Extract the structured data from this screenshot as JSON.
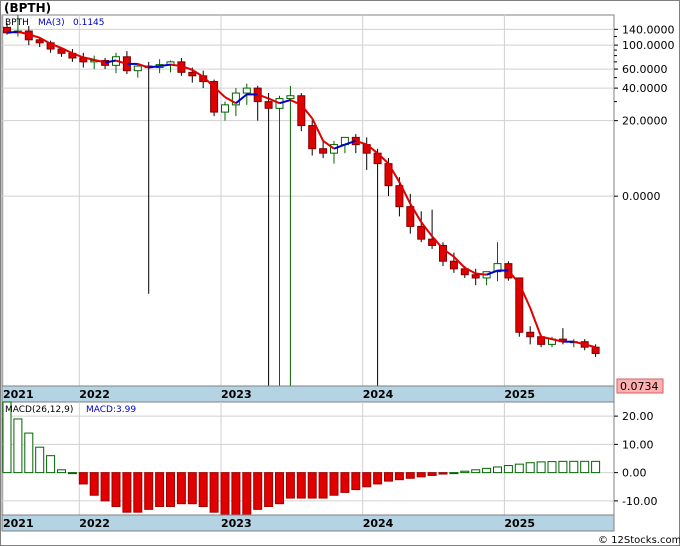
{
  "title": "(BPTH)",
  "price_panel": {
    "ticker": "BPTH",
    "ma_label": "MA(3)",
    "ma_value": "0.1145",
    "last_price_label": "0.0734",
    "y_tick_labels": [
      "140.0000",
      "100.0000",
      "60.0000",
      "40.0000",
      "20.0000",
      "0.0000"
    ],
    "y_tick_values": [
      140,
      100,
      60,
      40,
      20,
      0
    ]
  },
  "macd_panel": {
    "label": "MACD(26,12,9)",
    "value_label": "MACD:3.99",
    "y_tick_labels": [
      "20.00",
      "10.00",
      "0.00",
      "-10.00"
    ],
    "y_tick_values": [
      20,
      10,
      0,
      -10
    ]
  },
  "x_axis_labels": [
    "2021",
    "2022",
    "2023",
    "2024",
    "2025"
  ],
  "watermark": "© 12Stocks.com",
  "colors": {
    "up_candle": "#ffffff",
    "up_outline": "#006400",
    "down_candle": "#e00000",
    "ma_up": "#0000cc",
    "ma_down": "#e00000",
    "macd_pos": "#ffffff",
    "macd_pos_outline": "#006400",
    "macd_neg": "#e00000",
    "axis_band": "#b4d4e4",
    "last_price_bg": "#ffb0b0"
  },
  "chart_data": [
    {
      "type": "candlestick",
      "title": "(BPTH)",
      "y_scale": "log",
      "period": "monthly",
      "series": [
        {
          "name": "BPTH",
          "ohlc": [
            [
              146,
              160,
              125,
              130
            ],
            [
              130,
              190,
              120,
              135
            ],
            [
              135,
              150,
              100,
              112
            ],
            [
              112,
              118,
              96,
              105
            ],
            [
              105,
              110,
              85,
              92
            ],
            [
              92,
              95,
              78,
              84
            ],
            [
              84,
              92,
              70,
              76
            ],
            [
              76,
              85,
              62,
              70
            ],
            [
              70,
              80,
              60,
              72
            ],
            [
              72,
              76,
              60,
              65
            ],
            [
              65,
              85,
              55,
              78
            ],
            [
              78,
              88,
              54,
              58
            ],
            [
              58,
              66,
              50,
              64
            ],
            [
              64,
              70,
              0.5,
              62
            ],
            [
              62,
              74,
              55,
              66
            ],
            [
              66,
              72,
              56,
              70
            ],
            [
              70,
              76,
              52,
              56
            ],
            [
              56,
              62,
              45,
              52
            ],
            [
              52,
              58,
              40,
              46
            ],
            [
              46,
              48,
              22,
              24
            ],
            [
              24,
              30,
              20,
              28
            ],
            [
              28,
              40,
              22,
              36
            ],
            [
              36,
              44,
              28,
              40
            ],
            [
              40,
              42,
              20,
              30
            ],
            [
              30,
              36,
              0.06,
              26
            ],
            [
              26,
              34,
              0.06,
              32
            ],
            [
              32,
              42,
              0.06,
              34
            ],
            [
              34,
              36,
              16,
              18
            ],
            [
              18,
              20,
              9.5,
              11
            ],
            [
              11,
              13,
              9,
              10
            ],
            [
              10,
              13,
              8,
              12
            ],
            [
              12,
              14,
              10,
              14
            ],
            [
              14,
              15,
              10,
              12
            ],
            [
              12,
              14,
              7,
              10
            ],
            [
              10,
              11,
              0.02,
              8
            ],
            [
              8,
              9,
              4,
              5
            ],
            [
              5,
              6,
              2.6,
              3.2
            ],
            [
              3.2,
              4.2,
              1.8,
              2.1
            ],
            [
              2.1,
              2.9,
              1.5,
              1.6
            ],
            [
              1.6,
              3,
              1.3,
              1.4
            ],
            [
              1.4,
              1.5,
              0.9,
              1
            ],
            [
              1,
              1.2,
              0.78,
              0.85
            ],
            [
              0.85,
              0.9,
              0.7,
              0.75
            ],
            [
              0.75,
              0.85,
              0.6,
              0.7
            ],
            [
              0.7,
              0.8,
              0.6,
              0.8
            ],
            [
              0.8,
              1.5,
              0.65,
              0.95
            ],
            [
              0.95,
              1,
              0.66,
              0.7
            ],
            [
              0.7,
              0.7,
              0.2,
              0.22
            ],
            [
              0.22,
              0.25,
              0.17,
              0.2
            ],
            [
              0.2,
              0.21,
              0.16,
              0.17
            ],
            [
              0.17,
              0.2,
              0.16,
              0.19
            ],
            [
              0.19,
              0.24,
              0.17,
              0.18
            ],
            [
              0.18,
              0.19,
              0.16,
              0.18
            ],
            [
              0.18,
              0.19,
              0.15,
              0.16
            ],
            [
              0.16,
              0.17,
              0.13,
              0.14
            ]
          ]
        },
        {
          "name": "MA(3)",
          "values": [
            130,
            133,
            126,
            117,
            103,
            94,
            84,
            77,
            73,
            69,
            72,
            67,
            67,
            62,
            64,
            66,
            64,
            59,
            51,
            41,
            33,
            29,
            35,
            35,
            32,
            29,
            31,
            28,
            21,
            13,
            11,
            12,
            13,
            12,
            10,
            8,
            5.4,
            3.4,
            2.3,
            1.7,
            1.3,
            1.1,
            0.87,
            0.77,
            0.75,
            0.82,
            0.82,
            0.62,
            0.37,
            0.2,
            0.19,
            0.18,
            0.18,
            0.17,
            0.16
          ]
        }
      ],
      "ylim": [
        0.07,
        190
      ]
    },
    {
      "type": "bar",
      "title": "MACD(26,12,9)",
      "series": [
        {
          "name": "MACD",
          "values": [
            25,
            19,
            14,
            9,
            6,
            1,
            0,
            -4,
            -8,
            -10,
            -12,
            -14,
            -14,
            -13,
            -12,
            -12,
            -11,
            -11,
            -12,
            -14,
            -15,
            -16,
            -15,
            -13,
            -12,
            -11,
            -9,
            -9,
            -9,
            -9,
            -8,
            -7,
            -6,
            -5,
            -4,
            -3,
            -2.5,
            -2,
            -1.5,
            -1,
            -0.5,
            0,
            0.5,
            1,
            1.5,
            2,
            2.5,
            3,
            3.5,
            3.8,
            3.9,
            4,
            4,
            4,
            3.99
          ]
        }
      ],
      "ylim": [
        -15,
        25
      ]
    }
  ]
}
